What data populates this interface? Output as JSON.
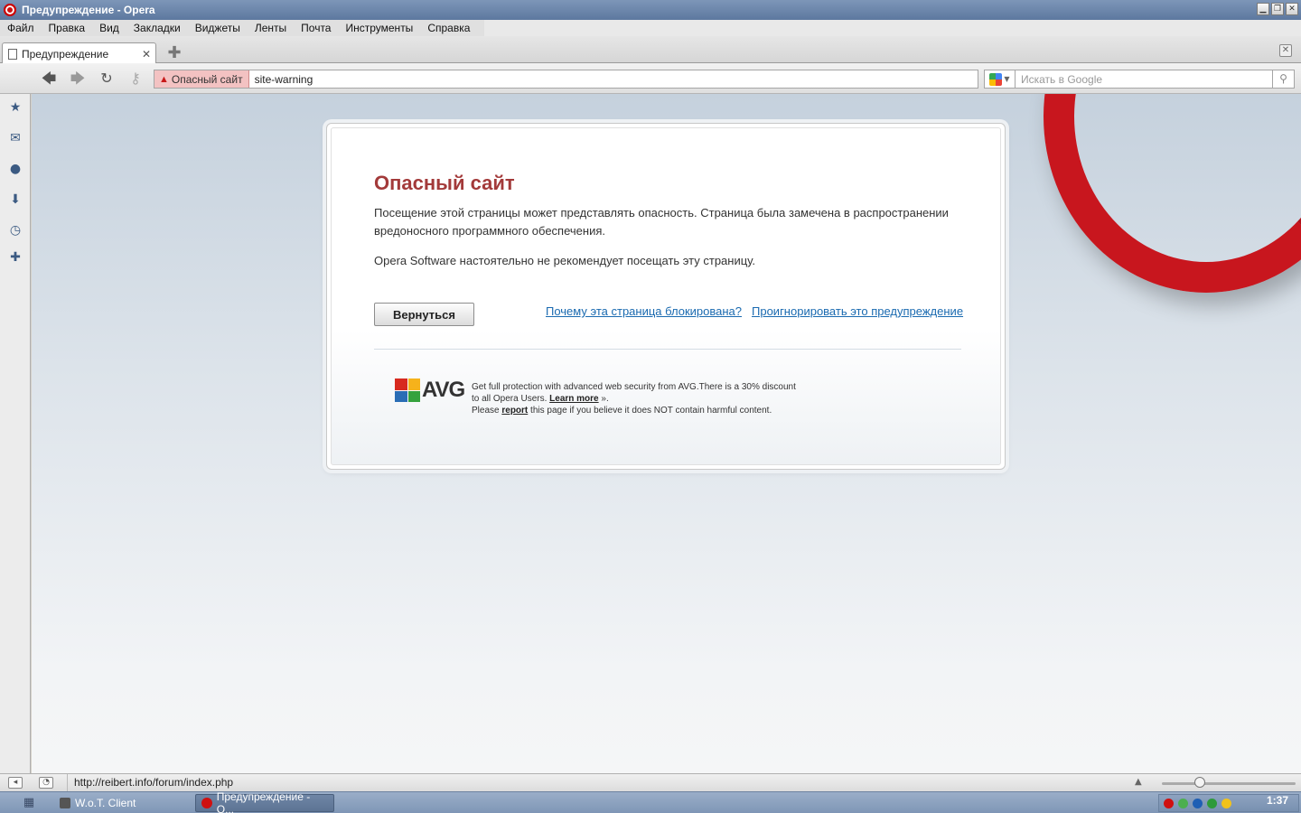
{
  "window": {
    "title": "Предупреждение - Opera"
  },
  "menubar": {
    "items": [
      "Файл",
      "Правка",
      "Вид",
      "Закладки",
      "Виджеты",
      "Ленты",
      "Почта",
      "Инструменты",
      "Справка"
    ]
  },
  "tabs": [
    {
      "label": "Предупреждение"
    }
  ],
  "address": {
    "security_label": "Опасный сайт",
    "url": "site-warning",
    "search_placeholder": "Искать в Google"
  },
  "sidepanel": {
    "icons": [
      "star-icon",
      "mail-icon",
      "contacts-icon",
      "downloads-icon",
      "history-icon",
      "add-panel-icon"
    ]
  },
  "warning": {
    "title": "Опасный сайт",
    "text1": "Посещение этой страницы может представлять опасность. Страница была замечена в распространении вредоносного программного обеспечения.",
    "text2": "Opera Software настоятельно не рекомендует посещать эту страницу.",
    "back_button": "Вернуться",
    "why_link": "Почему эта страница блокирована?",
    "ignore_link": "Проигнорировать это предупреждение",
    "avg_logo": "AVG",
    "avg_line1": "Get full protection with advanced web security from AVG.There is a 30% discount",
    "avg_line2_pre": "to all Opera Users.",
    "avg_learn_more": "Learn more",
    "avg_line2_post": "».",
    "avg_line3_pre": "Please",
    "avg_report": "report",
    "avg_line3_post": "this page if you believe it does NOT contain harmful content."
  },
  "statusbar": {
    "url": "http://reibert.info/forum/index.php"
  },
  "taskbar": {
    "items": [
      {
        "label": "W.o.T. Client"
      },
      {
        "label": "Предупреждение - O..."
      }
    ],
    "clock": "1:37"
  },
  "colors": {
    "accent_red": "#c8161e",
    "warning_title": "#a33a3a",
    "link": "#1a6ab0"
  }
}
